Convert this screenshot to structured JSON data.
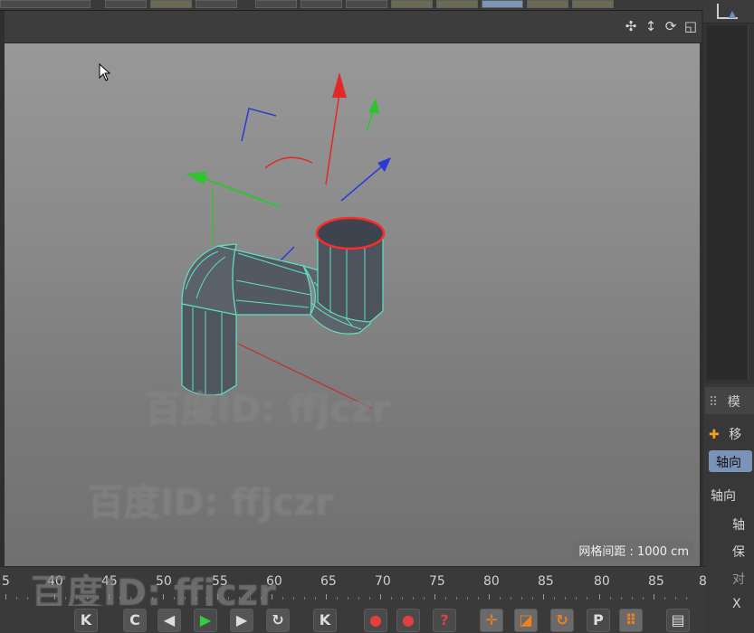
{
  "viewport": {
    "grid_spacing_label": "网格间距 : 1000 cm",
    "nav_icons": [
      "move-view-icon",
      "dolly-icon",
      "rotate-view-icon",
      "toggle-view-icon"
    ]
  },
  "watermarks": [
    "百度ID: ffjczr",
    "百度ID: ffjczr",
    "百度ID: ffjczr"
  ],
  "attributes_panel": {
    "header": "模",
    "move_label": "移",
    "axis_tab": "轴向",
    "axis_section": "轴向",
    "row1": "轴",
    "row2": "保",
    "row3": "对",
    "row4": "X"
  },
  "timeline": {
    "ticks": [
      "5",
      "40",
      "45",
      "50",
      "55",
      "60",
      "65",
      "70",
      "75",
      "80",
      "85",
      "80",
      "85",
      "8"
    ]
  },
  "transport": {
    "buttons": [
      "first-frame-icon",
      "prev-key-icon",
      "prev-frame-icon",
      "play-icon",
      "next-frame-icon",
      "next-key-icon",
      "last-frame-icon",
      "record-icon",
      "autokey-icon",
      "help-icon",
      "move-tool-icon",
      "scale-tool-icon",
      "rotate-tool-icon",
      "param-icon",
      "grid-icon",
      "film-icon"
    ],
    "labels": {
      "first": "K",
      "prev_key": "C",
      "prev_frame": "◀",
      "play": "▶",
      "next_frame": "▶",
      "next_key": "↻",
      "last": "K",
      "record": "●",
      "autokey": "●",
      "help": "?",
      "move": "✛",
      "scale": "◪",
      "rotate": "↻",
      "param": "P",
      "grid": "⠿",
      "film": "▤"
    }
  },
  "colors": {
    "x_axis": "#e02a2a",
    "y_axis": "#2ec42e",
    "z_axis": "#2a3ad8",
    "mesh_edge": "#60e0c0",
    "selected_edge": "#ff2a2a",
    "accent_tab": "#7a93b8"
  }
}
